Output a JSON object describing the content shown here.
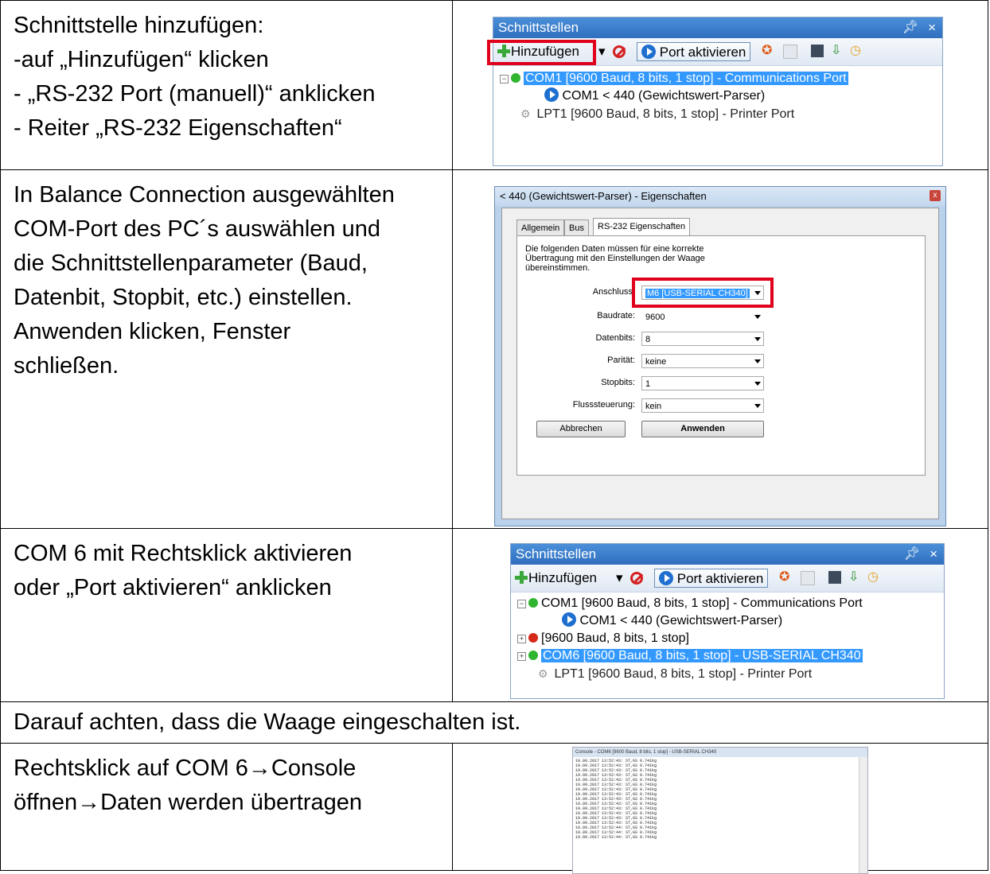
{
  "rows": [
    {
      "lines": [
        "Schnittstelle hinzufügen:",
        "-auf „Hinzufügen“ klicken",
        "- „RS-232 Port (manuell)“ anklicken",
        "- Reiter „RS-232 Eigenschaften“"
      ]
    },
    {
      "lines": [
        "In Balance Connection ausgewählten",
        "COM-Port des PC´s auswählen und",
        "die Schnittstellenparameter (Baud,",
        "Datenbit, Stopbit, etc.) einstellen.",
        "",
        "Anwenden klicken, Fenster",
        "schließen."
      ]
    },
    {
      "lines": [
        "COM 6 mit Rechtsklick aktivieren",
        "oder „Port aktivieren“ anklicken"
      ]
    },
    {
      "lines": [
        "Darauf achten, dass die Waage eingeschalten ist."
      ]
    },
    {
      "lines": [
        "Rechtsklick auf COM 6→Console",
        "öffnen→Daten werden übertragen"
      ]
    }
  ],
  "panel": {
    "title": "Schnittstellen",
    "pin": "p",
    "close": "×",
    "add_label": "Hinzufügen",
    "dropdown_arrow": "▾",
    "port_activate_label": "Port aktivieren"
  },
  "tree1": [
    "COM1 [9600 Baud, 8 bits, 1 stop] - Communications Port",
    "COM1 < 440 (Gewichtswert-Parser)",
    "LPT1 [9600 Baud, 8 bits, 1 stop] - Printer Port"
  ],
  "tree2": [
    "COM1 [9600 Baud, 8 bits, 1 stop] - Communications Port",
    "COM1 < 440 (Gewichtswert-Parser)",
    "[9600 Baud, 8 bits, 1 stop]",
    "COM6 [9600 Baud, 8 bits, 1 stop] - USB-SERIAL CH340",
    "LPT1 [9600 Baud, 8 bits, 1 stop] - Printer Port"
  ],
  "dialog": {
    "title": "< 440 (Gewichtswert-Parser) - Eigenschaften",
    "close": "x",
    "tabs": [
      "Allgemein",
      "Bus",
      "RS-232 Eigenschaften"
    ],
    "description": [
      "Die folgenden Daten müssen für eine korrekte",
      "Übertragung mit den Einstellungen der Waage",
      "übereinstimmen."
    ],
    "fields": [
      {
        "label": "Anschluss:",
        "value": "M6 [USB-SERIAL CH340]"
      },
      {
        "label": "Baudrate:",
        "value": "9600"
      },
      {
        "label": "Datenbits:",
        "value": "8"
      },
      {
        "label": "Parität:",
        "value": "keine"
      },
      {
        "label": "Stopbits:",
        "value": "1"
      },
      {
        "label": "Flusssteuerung:",
        "value": "kein"
      }
    ],
    "cancel": "Abbrechen",
    "apply": "Anwenden"
  },
  "console": {
    "title": "Console - COM6 [9600 Baud, 8 bits, 1 stop] - USB-SERIAL CH340",
    "lines": [
      "19.09.2017 13:52:43: ST,GS 0.741kg",
      "19.09.2017 13:52:43: ST,GS 0.741kg",
      "19.09.2017 13:52:43: ST,GS 0.741kg",
      "19.09.2017 13:52:43: ST,GS 0.741kg",
      "19.09.2017 13:52:43: ST,GS 0.741kg",
      "19.09.2017 13:52:43: ST,GS 0.741kg",
      "19.09.2017 13:52:43: ST,GS 0.741kg",
      "19.09.2017 13:52:43: ST,GS 0.741kg",
      "19.09.2017 13:52:43: ST,GS 0.741kg",
      "19.09.2017 13:52:43: ST,GS 0.741kg",
      "19.09.2017 13:52:43: ST,GS 0.741kg",
      "19.09.2017 13:52:43: ST,GS 0.741kg",
      "19.09.2017 13:52:43: ST,GS 0.741kg",
      "19.09.2017 13:52:43: ST,GS 0.741kg",
      "19.09.2017 13:52:44: ST,GS 0.741kg",
      "19.09.2017 13:52:44: ST,GS 0.741kg",
      "19.09.2017 13:52:44: ST,GS 0.741kg"
    ]
  }
}
